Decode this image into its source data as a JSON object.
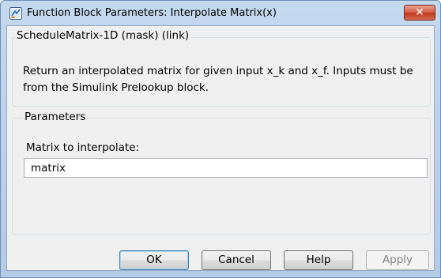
{
  "window": {
    "title": "Function Block Parameters: Interpolate Matrix(x)",
    "close_glyph": "✕",
    "app_icon": "simulink-block-icon"
  },
  "mask_group": {
    "title": "ScheduleMatrix-1D (mask) (link)",
    "description": "Return an interpolated matrix for given input x_k and x_f. Inputs must be from the Simulink Prelookup block."
  },
  "parameters_group": {
    "title": "Parameters",
    "matrix_label": "Matrix to interpolate:",
    "matrix_value": "matrix"
  },
  "buttons": {
    "ok": "OK",
    "cancel": "Cancel",
    "help": "Help",
    "apply": "Apply"
  },
  "colors": {
    "title_bar": "#c4d8ee",
    "close_button": "#c23a1f",
    "client_bg": "#f0f0f0",
    "default_button_border": "#3c7fb1",
    "disabled_text": "#838383"
  }
}
